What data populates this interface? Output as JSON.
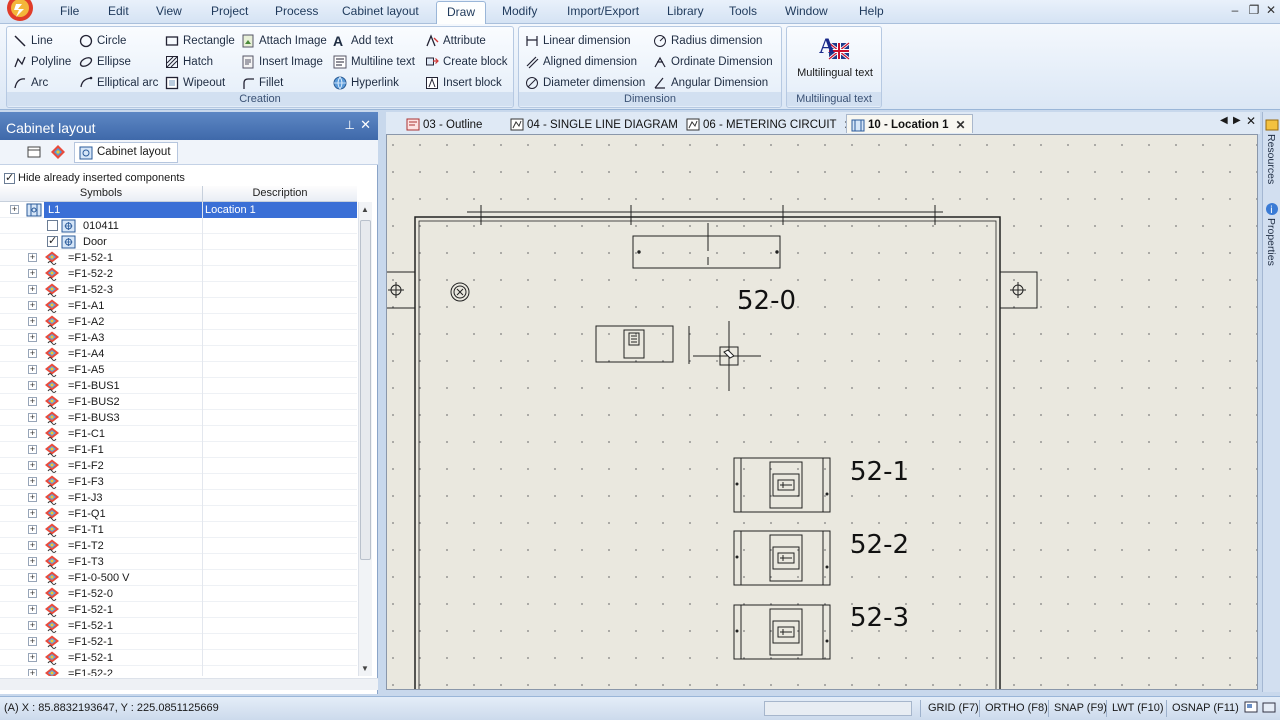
{
  "menu": {
    "items": [
      "File",
      "Edit",
      "View",
      "Project",
      "Process",
      "Cabinet layout",
      "Draw",
      "Modify",
      "Import/Export",
      "Library",
      "Tools",
      "Window",
      "Help"
    ],
    "active": "Draw"
  },
  "ribbon": {
    "creation": {
      "label": "Creation",
      "buttons": [
        "Line",
        "Circle",
        "Rectangle",
        "Attach Image",
        "Add text",
        "Attribute",
        "Polyline",
        "Ellipse",
        "Hatch",
        "Insert Image",
        "Multiline text",
        "Create block",
        "Arc",
        "Elliptical arc",
        "Wipeout",
        "Fillet",
        "Hyperlink",
        "Insert block"
      ]
    },
    "dimension": {
      "label": "Dimension",
      "buttons": [
        "Linear dimension",
        "Radius dimension",
        "Aligned dimension",
        "Ordinate Dimension",
        "Diameter dimension",
        "Angular Dimension"
      ]
    },
    "multilingual": {
      "label": "Multilingual text",
      "button": "Multilingual text"
    }
  },
  "panel": {
    "title": "Cabinet layout",
    "tab_label": "Cabinet layout",
    "hide_label": "Hide already inserted components",
    "hide_checked": true,
    "columns": [
      "Symbols",
      "Description"
    ],
    "rows": [
      {
        "label": "L1",
        "desc": "Location 1",
        "selected": true,
        "level": 0
      },
      {
        "label": "010411",
        "desc": "",
        "level": 1,
        "checked": false
      },
      {
        "label": "Door",
        "desc": "",
        "level": 1,
        "checked": true
      },
      {
        "label": "=F1-52-1",
        "level": 2
      },
      {
        "label": "=F1-52-2",
        "level": 2
      },
      {
        "label": "=F1-52-3",
        "level": 2
      },
      {
        "label": "=F1-A1",
        "level": 2
      },
      {
        "label": "=F1-A2",
        "level": 2
      },
      {
        "label": "=F1-A3",
        "level": 2
      },
      {
        "label": "=F1-A4",
        "level": 2
      },
      {
        "label": "=F1-A5",
        "level": 2
      },
      {
        "label": "=F1-BUS1",
        "level": 2
      },
      {
        "label": "=F1-BUS2",
        "level": 2
      },
      {
        "label": "=F1-BUS3",
        "level": 2
      },
      {
        "label": "=F1-C1",
        "level": 2
      },
      {
        "label": "=F1-F1",
        "level": 2
      },
      {
        "label": "=F1-F2",
        "level": 2
      },
      {
        "label": "=F1-F3",
        "level": 2
      },
      {
        "label": "=F1-J3",
        "level": 2
      },
      {
        "label": "=F1-Q1",
        "level": 2
      },
      {
        "label": "=F1-T1",
        "level": 2
      },
      {
        "label": "=F1-T2",
        "level": 2
      },
      {
        "label": "=F1-T3",
        "level": 2
      },
      {
        "label": "=F1-0-500 V",
        "level": 2
      },
      {
        "label": "=F1-52-0",
        "level": 2
      },
      {
        "label": "=F1-52-1",
        "level": 2
      },
      {
        "label": "=F1-52-1",
        "level": 2
      },
      {
        "label": "=F1-52-1",
        "level": 2
      },
      {
        "label": "=F1-52-1",
        "level": 2
      },
      {
        "label": "=F1-52-2",
        "level": 2
      }
    ]
  },
  "doc_tabs": [
    {
      "label": "03 - Outline",
      "active": false
    },
    {
      "label": "04 - SINGLE LINE DIAGRAM",
      "active": false
    },
    {
      "label": "06 - METERING CIRCUIT",
      "active": false
    },
    {
      "label": "10 - Location 1",
      "active": true
    }
  ],
  "drawing": {
    "labels": [
      "52-0",
      "52-1",
      "52-2",
      "52-3"
    ]
  },
  "side_tabs": [
    "Resources",
    "Properties"
  ],
  "status": {
    "coords": "(A) X : 85.8832193647, Y : 225.0851125669",
    "toggles": [
      "GRID (F7)",
      "ORTHO (F8)",
      "SNAP (F9)",
      "LWT (F10)",
      "OSNAP (F11)"
    ]
  },
  "colors": {
    "accent": "#3a6fd6",
    "panel_title": "#4a74b6",
    "canvas": "#eae8df"
  }
}
